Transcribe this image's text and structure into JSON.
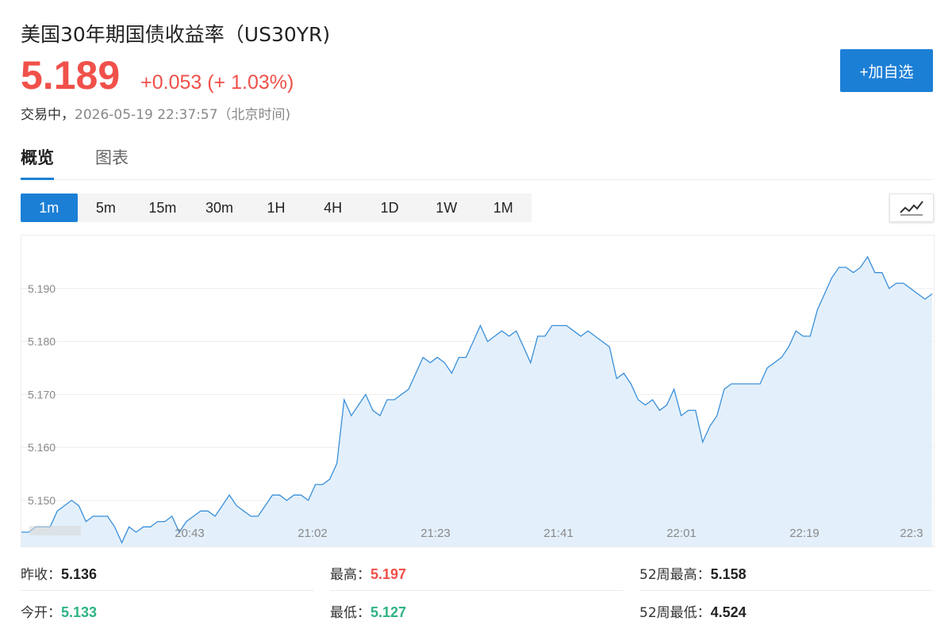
{
  "header": {
    "title": "美国30年期国债收益率（US30YR)",
    "price": "5.189",
    "change": "+0.053 (+ 1.03%)",
    "status_label": "交易中，",
    "timestamp": "2026-05-19 22:37:57（北京时间)",
    "add_button": "+加自选",
    "accent_color": "#1c7fd6",
    "up_color": "#f0504a",
    "down_color": "#2fb383"
  },
  "tabs": [
    {
      "label": "概览",
      "active": true
    },
    {
      "label": "图表",
      "active": false
    }
  ],
  "periods": [
    {
      "label": "1m",
      "active": true
    },
    {
      "label": "5m"
    },
    {
      "label": "15m"
    },
    {
      "label": "30m"
    },
    {
      "label": "1H"
    },
    {
      "label": "4H"
    },
    {
      "label": "1D"
    },
    {
      "label": "1W"
    },
    {
      "label": "1M"
    }
  ],
  "chart_type_icon": "line-chart-icon",
  "chart_data": {
    "type": "area",
    "ylim": [
      5.141,
      5.2
    ],
    "yticks": [
      5.15,
      5.16,
      5.17,
      5.18,
      5.19
    ],
    "ytick_labels": [
      "5.150",
      "5.160",
      "5.170",
      "5.180",
      "5.190"
    ],
    "xtick_labels": [
      "20:43",
      "21:02",
      "21:23",
      "21:41",
      "22:01",
      "22:19",
      "22:3"
    ],
    "grid": true,
    "line_color": "#3a8fd9",
    "fill_color": "#e3f0fb",
    "series": [
      {
        "values": [
          5.144,
          5.144,
          5.145,
          5.145,
          5.145,
          5.148,
          5.149,
          5.15,
          5.149,
          5.146,
          5.147,
          5.147,
          5.147,
          5.145,
          5.142,
          5.145,
          5.144,
          5.145,
          5.145,
          5.146,
          5.146,
          5.147,
          5.144,
          5.146,
          5.147,
          5.148,
          5.148,
          5.147,
          5.149,
          5.151,
          5.149,
          5.148,
          5.147,
          5.147,
          5.149,
          5.151,
          5.151,
          5.15,
          5.151,
          5.151,
          5.15,
          5.153,
          5.153,
          5.154,
          5.157,
          5.169,
          5.166,
          5.168,
          5.17,
          5.167,
          5.166,
          5.169,
          5.169,
          5.17,
          5.171,
          5.174,
          5.177,
          5.176,
          5.177,
          5.176,
          5.174,
          5.177,
          5.177,
          5.18,
          5.183,
          5.18,
          5.181,
          5.182,
          5.181,
          5.182,
          5.179,
          5.176,
          5.181,
          5.181,
          5.183,
          5.183,
          5.183,
          5.182,
          5.181,
          5.182,
          5.181,
          5.18,
          5.179,
          5.173,
          5.174,
          5.172,
          5.169,
          5.168,
          5.169,
          5.167,
          5.168,
          5.171,
          5.166,
          5.167,
          5.167,
          5.161,
          5.164,
          5.166,
          5.171,
          5.172,
          5.172,
          5.172,
          5.172,
          5.172,
          5.175,
          5.176,
          5.177,
          5.179,
          5.182,
          5.181,
          5.181,
          5.186,
          5.189,
          5.192,
          5.194,
          5.194,
          5.193,
          5.194,
          5.196,
          5.193,
          5.193,
          5.19,
          5.191,
          5.191,
          5.19,
          5.189,
          5.188,
          5.189
        ]
      }
    ]
  },
  "stats": [
    {
      "label": "昨收：",
      "value": "5.136",
      "tone": "dark"
    },
    {
      "label": "最高：",
      "value": "5.197",
      "tone": "red"
    },
    {
      "label": "52周最高：",
      "value": "5.158",
      "tone": "dark"
    },
    {
      "label": "今开：",
      "value": "5.133",
      "tone": "green"
    },
    {
      "label": "最低：",
      "value": "5.127",
      "tone": "green"
    },
    {
      "label": "52周最低：",
      "value": "4.524",
      "tone": "dark"
    }
  ]
}
